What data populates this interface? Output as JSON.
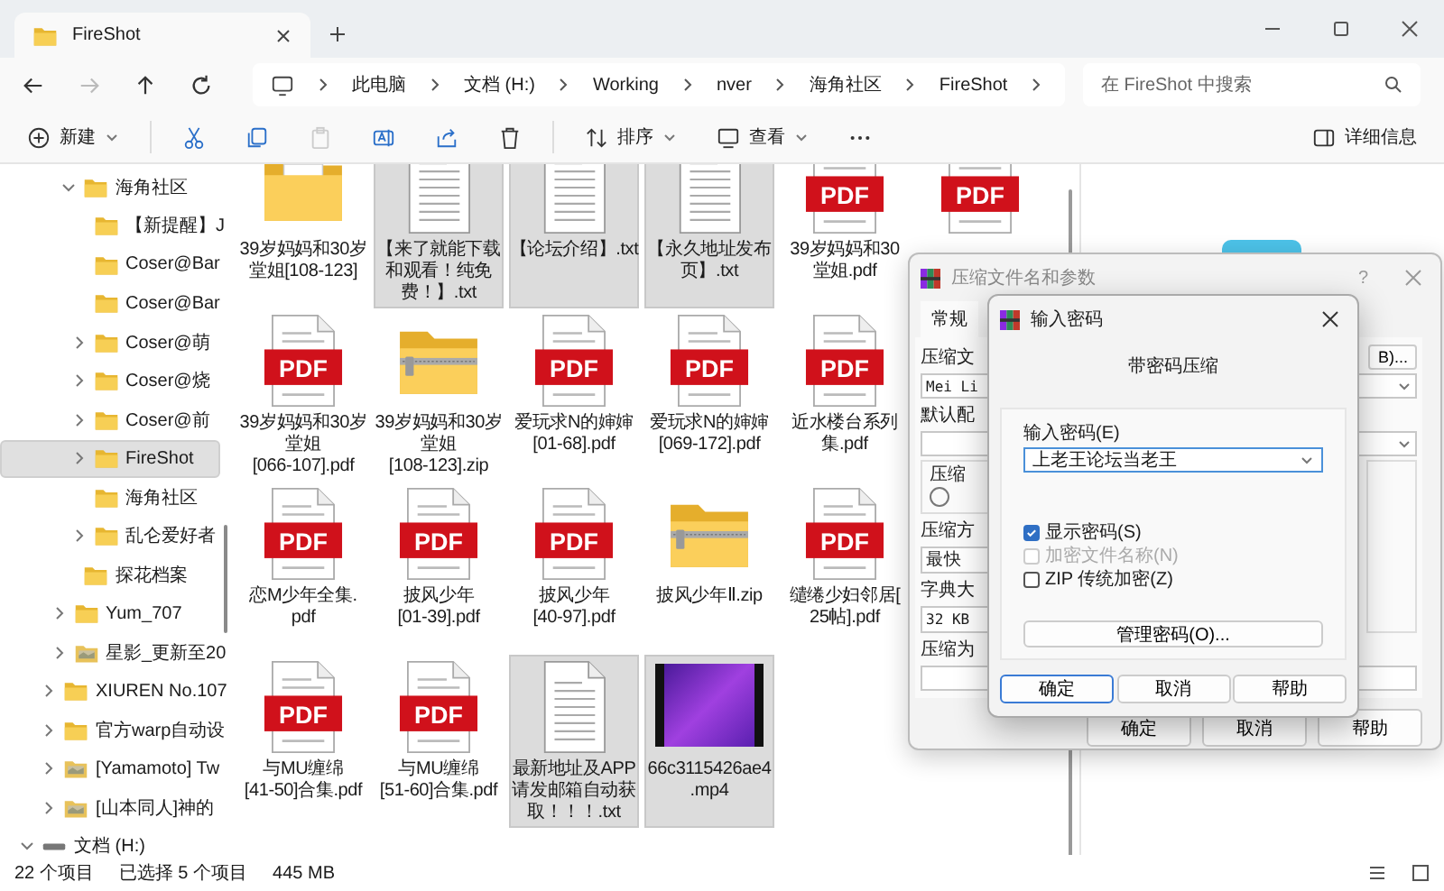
{
  "window": {
    "tab_title": "FireShot"
  },
  "nav": [
    {
      "kind": "back",
      "disabled": false
    },
    {
      "kind": "forward",
      "disabled": true
    },
    {
      "kind": "up",
      "disabled": false
    },
    {
      "kind": "refresh",
      "disabled": false
    }
  ],
  "address": {
    "crumbs": [
      "此电脑",
      "文档 (H:)",
      "Working",
      "nver",
      "海角社区",
      "FireShot"
    ]
  },
  "search": {
    "placeholder": "在 FireShot 中搜索"
  },
  "toolbar": {
    "buttons": [
      {
        "kind": "new",
        "label": "新建",
        "disabled": false
      },
      {
        "kind": "cut",
        "disabled": false
      },
      {
        "kind": "copy",
        "disabled": false
      },
      {
        "kind": "paste",
        "disabled": true
      },
      {
        "kind": "rename",
        "disabled": false
      },
      {
        "kind": "share",
        "disabled": false
      },
      {
        "kind": "delete",
        "disabled": false
      },
      {
        "kind": "sort",
        "label": "排序",
        "disabled": false
      },
      {
        "kind": "view",
        "label": "查看",
        "disabled": false
      },
      {
        "kind": "more",
        "disabled": false
      }
    ],
    "details": "详细信息"
  },
  "sidebar": {
    "tree": [
      {
        "children": [
          {
            "children": [
              {
                "label": "海角社区",
                "kind": "folder",
                "expandable": true,
                "expanded": true,
                "selected": false,
                "children": [
                  {
                    "label": "【新提醒】J",
                    "kind": "folder",
                    "expandable": false,
                    "selected": false
                  },
                  {
                    "label": "Coser@Bar",
                    "kind": "folder",
                    "expandable": false,
                    "selected": false
                  },
                  {
                    "label": "Coser@Bar",
                    "kind": "folder",
                    "expandable": false,
                    "selected": false
                  },
                  {
                    "label": "Coser@萌",
                    "kind": "folder",
                    "expandable": true,
                    "expanded": false,
                    "selected": false
                  },
                  {
                    "label": "Coser@烧",
                    "kind": "folder",
                    "expandable": true,
                    "expanded": false,
                    "selected": false
                  },
                  {
                    "label": "Coser@前",
                    "kind": "folder",
                    "expandable": true,
                    "expanded": false,
                    "selected": false
                  },
                  {
                    "label": "FireShot",
                    "kind": "folder",
                    "expandable": true,
                    "expanded": false,
                    "selected": true
                  },
                  {
                    "label": "海角社区",
                    "kind": "folder",
                    "expandable": false,
                    "selected": false
                  },
                  {
                    "label": "乱仑爱好者",
                    "kind": "folder",
                    "expandable": true,
                    "expanded": false,
                    "selected": false
                  }
                ]
              },
              {
                "label": "探花档案",
                "kind": "folder",
                "expandable": false,
                "selected": false
              }
            ]
          },
          {
            "label": "Yum_707",
            "kind": "folder",
            "expandable": true,
            "expanded": false,
            "selected": false
          },
          {
            "label": "星影_更新至20",
            "kind": "photo-folder",
            "expandable": true,
            "expanded": false,
            "selected": false
          }
        ]
      },
      {
        "label": "XIUREN No.107",
        "kind": "folder",
        "expandable": true,
        "expanded": false,
        "selected": false
      },
      {
        "label": "官方warp自动设",
        "kind": "folder",
        "expandable": true,
        "expanded": false,
        "selected": false
      },
      {
        "label": "[Yamamoto] Tw",
        "kind": "photo-folder",
        "expandable": true,
        "expanded": false,
        "selected": false
      },
      {
        "label": "[山本同人]神的",
        "kind": "photo-folder",
        "expandable": true,
        "expanded": false,
        "selected": false
      }
    ],
    "drive": {
      "label": "文档 (H:)",
      "expanded": true
    }
  },
  "file_rows": [
    [
      {
        "kind": "folder",
        "name_lines": [
          "39岁妈妈和30岁",
          "堂姐[108-123]"
        ],
        "selected": false
      },
      {
        "kind": "txt",
        "name_lines": [
          "【来了就能下载",
          "和观看！纯免",
          "费！】.txt"
        ],
        "selected": true
      },
      {
        "kind": "txt",
        "name_lines": [
          "【论坛介绍】.txt"
        ],
        "selected": true
      },
      {
        "kind": "txt",
        "name_lines": [
          "【永久地址发布",
          "页】.txt"
        ],
        "selected": true
      },
      {
        "kind": "pdf",
        "icon_text": "PDF",
        "name_lines": [
          "39岁妈妈和30",
          "堂姐.pdf"
        ],
        "selected": false
      },
      {
        "kind": "pdf",
        "icon_text": "PDF",
        "selected": false
      }
    ],
    [
      {
        "kind": "pdf",
        "icon_text": "PDF",
        "name_lines": [
          "39岁妈妈和30岁",
          "堂姐",
          "[066-107].pdf"
        ],
        "selected": false
      },
      {
        "kind": "zip",
        "name_lines": [
          "39岁妈妈和30岁",
          "堂姐",
          "[108-123].zip"
        ],
        "selected": false
      },
      {
        "kind": "pdf",
        "icon_text": "PDF",
        "name_lines": [
          "爱玩求N的婶婶",
          "[01-68].pdf"
        ],
        "selected": false
      },
      {
        "kind": "pdf",
        "icon_text": "PDF",
        "name_lines": [
          "爱玩求N的婶婶",
          "[069-172].pdf"
        ],
        "selected": false
      },
      {
        "kind": "pdf",
        "icon_text": "PDF",
        "name_lines": [
          "近水楼台系列",
          "集.pdf"
        ],
        "selected": false
      }
    ],
    [
      {
        "kind": "pdf",
        "icon_text": "PDF",
        "name_lines": [
          "恋M少年全集.",
          "pdf"
        ],
        "selected": false
      },
      {
        "kind": "pdf",
        "icon_text": "PDF",
        "name_lines": [
          "披风少年",
          "[01-39].pdf"
        ],
        "selected": false
      },
      {
        "kind": "pdf",
        "icon_text": "PDF",
        "name_lines": [
          "披风少年",
          "[40-97].pdf"
        ],
        "selected": false
      },
      {
        "kind": "zip",
        "name_lines": [
          "披风少年Ⅱ.zip"
        ],
        "selected": false
      },
      {
        "kind": "pdf",
        "icon_text": "PDF",
        "name_lines": [
          "缱绻少妇邻居[",
          "25帖].pdf"
        ],
        "selected": false
      }
    ],
    [
      {
        "kind": "pdf",
        "icon_text": "PDF",
        "name_lines": [
          "与MU缠绵",
          "[41-50]合集.pdf"
        ],
        "selected": false
      },
      {
        "kind": "pdf",
        "icon_text": "PDF",
        "name_lines": [
          "与MU缠绵",
          "[51-60]合集.pdf"
        ],
        "selected": false
      },
      {
        "kind": "txt",
        "name_lines": [
          "最新地址及APP",
          "请发邮箱自动获",
          "取！！！.txt"
        ],
        "selected": true
      },
      {
        "kind": "video",
        "name_lines": [
          "66c3115426ae4",
          ".mp4"
        ],
        "selected": true
      }
    ]
  ],
  "status_bar": {
    "count": "22 个项目",
    "selection": "已选择 5 个项目",
    "size": "445 MB"
  },
  "archive_dialog": {
    "title": "压缩文件名和参数",
    "help": "?",
    "tab": "常规",
    "name_label": "压缩文",
    "browse": "B)...",
    "name_value": "Mei Li",
    "profile_label": "默认配",
    "group_label": "压缩",
    "radio_selected": false,
    "method_label": "压缩方",
    "method_value": "最快",
    "dict_label": "字典大",
    "dict_value": "32 KB",
    "split_label": "压缩为",
    "buttons": [
      "确定",
      "取消",
      "帮助"
    ]
  },
  "password_dialog": {
    "title": "输入密码",
    "heading": "带密码压缩",
    "field_label": "输入密码(E)",
    "password": "上老王论坛当老王",
    "options": [
      {
        "label": "显示密码(S)",
        "checked": true,
        "disabled": false
      },
      {
        "label": "加密文件名称(N)",
        "checked": false,
        "disabled": true
      },
      {
        "label": "ZIP 传统加密(Z)",
        "checked": false,
        "disabled": false
      }
    ],
    "manage": "管理密码(O)...",
    "buttons": [
      {
        "label": "确定",
        "selected": true
      },
      {
        "label": "取消",
        "selected": false
      },
      {
        "label": "帮助",
        "selected": false
      }
    ]
  }
}
